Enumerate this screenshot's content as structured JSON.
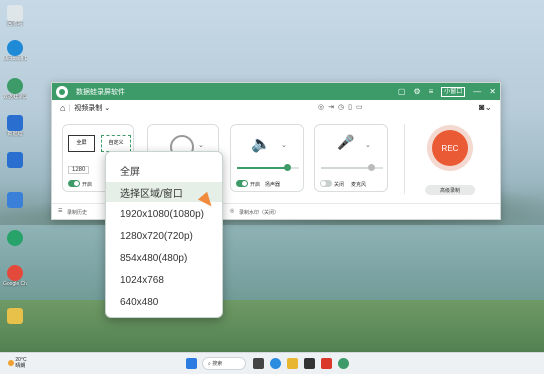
{
  "desktop": {
    "icons": [
      {
        "label": "回收站",
        "color": "#dfe6ea"
      },
      {
        "label": "Microsoft Edge",
        "color": "#1f8ad6"
      },
      {
        "label": "数据蛙录屏软件",
        "color": "#3c9b68"
      },
      {
        "label": "数据蛙",
        "color": "#2a6fd0"
      },
      {
        "label": "",
        "color": "#2a6fd0"
      },
      {
        "label": "",
        "color": "#3a7fd8"
      },
      {
        "label": "",
        "color": "#27a36a"
      },
      {
        "label": "",
        "color": "#e34a3c"
      },
      {
        "label": "Google Chrome",
        "color": "#e8b630"
      },
      {
        "label": "",
        "color": "#e8c14a"
      }
    ]
  },
  "app": {
    "title": "数据蛙录屏软件",
    "mini_window_label": "小窗口",
    "mode_label": "视频录制",
    "area_panel": {
      "fullscreen_label": "全屏",
      "custom_label": "自定义",
      "width_value": "1280",
      "toggle_label": "开启"
    },
    "speaker_panel": {
      "toggle_label": "开启",
      "sublabel": "扬声器",
      "volume": 0.8
    },
    "mic_panel": {
      "toggle_label": "关闭",
      "sublabel": "麦克风",
      "volume": 0.8
    },
    "rec_label": "REC",
    "advanced_label": "高级录制",
    "bottom": {
      "history_label": "录制历史",
      "watermark_label": "录制水印（关闭）"
    }
  },
  "dropdown": {
    "selected_index": 1,
    "items": [
      "全屏",
      "选择区域/窗口",
      "1920x1080(1080p)",
      "1280x720(720p)",
      "854x480(480p)",
      "1024x768",
      "640x480"
    ]
  },
  "taskbar": {
    "weather_temp": "20°C",
    "weather_desc": "晴朗",
    "search_label": "搜索"
  },
  "colors": {
    "brand": "#3c9b68",
    "rec": "#ea5a35"
  }
}
